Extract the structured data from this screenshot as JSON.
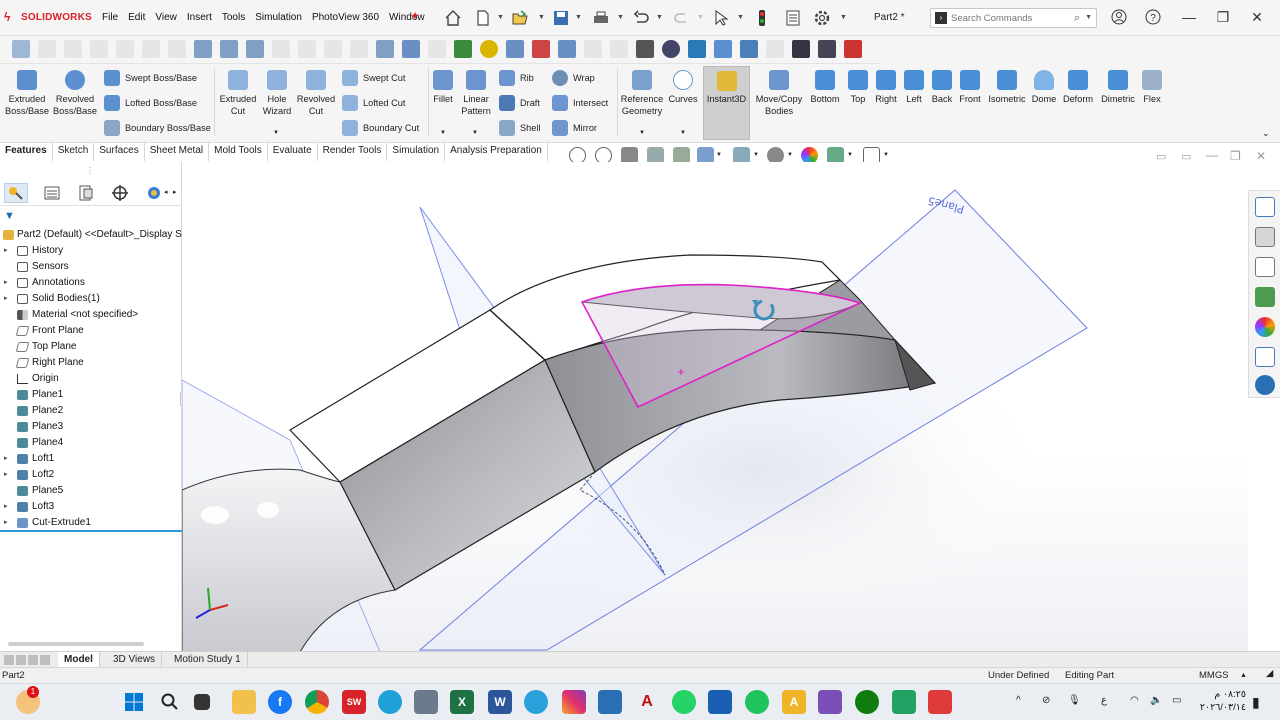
{
  "app": {
    "brand": "SOLIDWORKS",
    "menu": [
      "File",
      "Edit",
      "View",
      "Insert",
      "Tools",
      "Simulation",
      "PhotoView 360",
      "Window"
    ],
    "document_title": "Part2 *",
    "search_placeholder": "Search Commands"
  },
  "ribbon": {
    "boss": {
      "extruded": "Extruded Boss/Base",
      "revolved": "Revolved Boss/Base",
      "swept": "Swept Boss/Base",
      "lofted": "Lofted Boss/Base",
      "boundary": "Boundary Boss/Base"
    },
    "cut": {
      "extruded": "Extruded Cut",
      "hole_wizard": "Hole Wizard",
      "revolved": "Revolved Cut",
      "swept": "Swept Cut",
      "lofted": "Lofted Cut",
      "boundary": "Boundary Cut"
    },
    "features": {
      "fillet": "Fillet",
      "linear_pattern": "Linear Pattern",
      "rib": "Rib",
      "draft": "Draft",
      "shell": "Shell",
      "wrap": "Wrap",
      "intersect": "Intersect",
      "mirror": "Mirror",
      "reference_geometry": "Reference Geometry",
      "curves": "Curves",
      "instant3d": "Instant3D",
      "move_copy": "Move/Copy Bodies"
    },
    "views": [
      "Bottom",
      "Top",
      "Right",
      "Left",
      "Back",
      "Front",
      "Isometric",
      "Dome",
      "Deform",
      "Dimetric",
      "Flex"
    ]
  },
  "tabs": [
    "Features",
    "Sketch",
    "Surfaces",
    "Sheet Metal",
    "Mold Tools",
    "Evaluate",
    "Render Tools",
    "Simulation",
    "Analysis Preparation"
  ],
  "active_tab": "Features",
  "tree": {
    "root": "Part2 (Default) <<Default>_Display S",
    "items": [
      "History",
      "Sensors",
      "Annotations",
      "Solid Bodies(1)",
      "Material <not specified>",
      "Front Plane",
      "Top Plane",
      "Right Plane",
      "Origin",
      "Plane1",
      "Plane2",
      "Plane3",
      "Plane4",
      "Loft1",
      "Loft2",
      "Plane5",
      "Loft3",
      "Cut-Extrude1"
    ]
  },
  "viewport": {
    "plane_label": "Plane5"
  },
  "bottom_tabs": [
    "Model",
    "3D Views",
    "Motion Study 1"
  ],
  "status": {
    "doc": "Part2",
    "state": "Under Defined",
    "mode": "Editing Part",
    "units": "MMGS"
  },
  "taskbar": {
    "notification_count": "1",
    "lang": "ع",
    "time": "٠٨:٢٥ م",
    "date": "٢٠٢٦/٠٣/١٤"
  },
  "colors": {
    "accent": "#d8232a",
    "sketch": "#e020c8",
    "plane": "#4a63d8"
  }
}
